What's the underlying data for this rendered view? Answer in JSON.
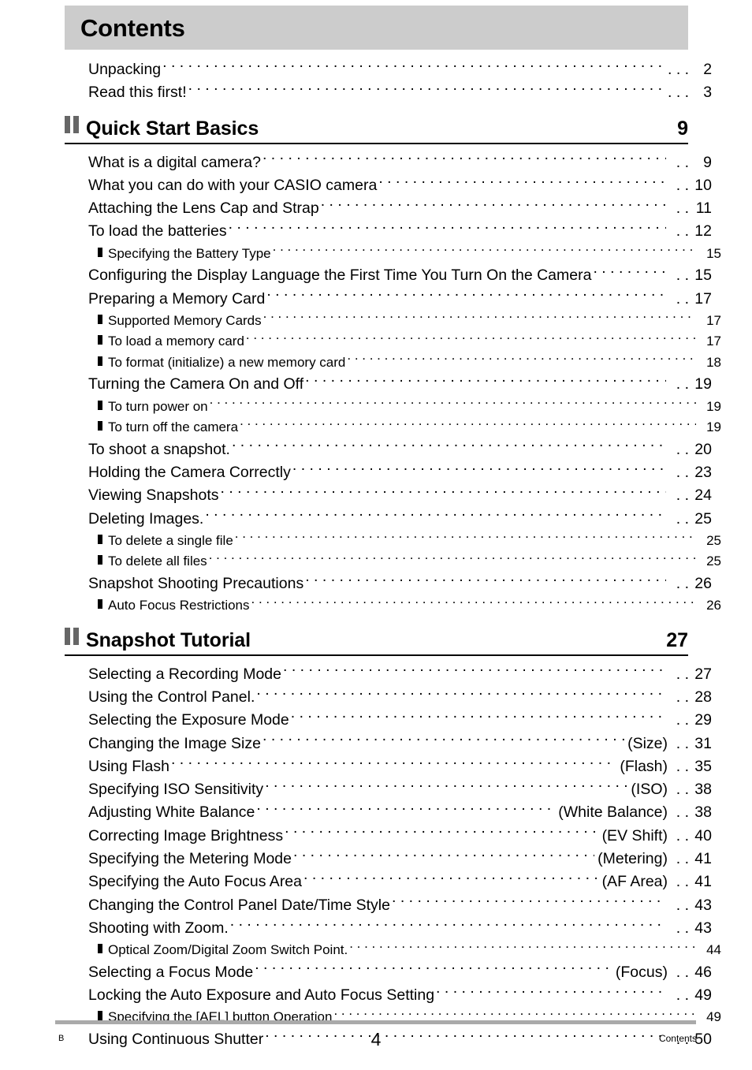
{
  "header": {
    "title": "Contents"
  },
  "intro_items": [
    {
      "label": "Unpacking",
      "page": "2"
    },
    {
      "label": "Read this first!",
      "page": "3"
    }
  ],
  "sections": [
    {
      "icon": "double-bar-icon",
      "title": "Quick Start Basics",
      "page": "9",
      "items": [
        {
          "level": 1,
          "label": "What is a digital camera?",
          "suffix": "",
          "page": "9"
        },
        {
          "level": 1,
          "label": "What you can do with your CASIO camera",
          "suffix": "",
          "page": "10"
        },
        {
          "level": 1,
          "label": "Attaching the Lens Cap and Strap",
          "suffix": "",
          "page": "11"
        },
        {
          "level": 1,
          "label": "To load the batteries",
          "suffix": "",
          "page": "12"
        },
        {
          "level": 2,
          "label": "Specifying the Battery Type",
          "suffix": "",
          "page": "15"
        },
        {
          "level": 1,
          "label": "Configuring the Display Language the First Time You Turn On the Camera",
          "suffix": "",
          "page": "15"
        },
        {
          "level": 1,
          "label": "Preparing a Memory Card",
          "suffix": "",
          "page": "17"
        },
        {
          "level": 2,
          "label": "Supported Memory Cards",
          "suffix": "",
          "page": "17"
        },
        {
          "level": 2,
          "label": "To load a memory card",
          "suffix": "",
          "page": "17"
        },
        {
          "level": 2,
          "label": "To format (initialize) a new memory card",
          "suffix": "",
          "page": "18"
        },
        {
          "level": 1,
          "label": "Turning the Camera On and Off",
          "suffix": "",
          "page": "19"
        },
        {
          "level": 2,
          "label": "To turn power on",
          "suffix": "",
          "page": "19"
        },
        {
          "level": 2,
          "label": "To turn off the camera",
          "suffix": "",
          "page": "19"
        },
        {
          "level": 1,
          "label": "To shoot a snapshot.",
          "suffix": "",
          "page": "20"
        },
        {
          "level": 1,
          "label": "Holding the Camera Correctly",
          "suffix": "",
          "page": "23"
        },
        {
          "level": 1,
          "label": "Viewing Snapshots",
          "suffix": "",
          "page": "24"
        },
        {
          "level": 1,
          "label": "Deleting Images.",
          "suffix": "",
          "page": "25"
        },
        {
          "level": 2,
          "label": "To delete a single file",
          "suffix": "",
          "page": "25"
        },
        {
          "level": 2,
          "label": "To delete all files",
          "suffix": "",
          "page": "25"
        },
        {
          "level": 1,
          "label": "Snapshot Shooting Precautions",
          "suffix": "",
          "page": "26"
        },
        {
          "level": 2,
          "label": "Auto Focus Restrictions",
          "suffix": "",
          "page": "26"
        }
      ]
    },
    {
      "icon": "double-bar-icon",
      "title": "Snapshot Tutorial",
      "page": "27",
      "items": [
        {
          "level": 1,
          "label": "Selecting a Recording Mode",
          "suffix": "",
          "page": "27"
        },
        {
          "level": 1,
          "label": "Using the Control Panel.",
          "suffix": "",
          "page": "28"
        },
        {
          "level": 1,
          "label": "Selecting the Exposure Mode",
          "suffix": "",
          "page": "29"
        },
        {
          "level": 1,
          "label": "Changing the Image Size",
          "suffix": "(Size)",
          "page": "31"
        },
        {
          "level": 1,
          "label": "Using Flash",
          "suffix": "(Flash)",
          "page": "35"
        },
        {
          "level": 1,
          "label": "Specifying ISO Sensitivity",
          "suffix": "(ISO)",
          "page": "38"
        },
        {
          "level": 1,
          "label": "Adjusting White Balance",
          "suffix": "(White Balance)",
          "page": "38"
        },
        {
          "level": 1,
          "label": "Correcting Image Brightness",
          "suffix": "(EV Shift)",
          "page": "40"
        },
        {
          "level": 1,
          "label": "Specifying the Metering Mode",
          "suffix": "(Metering)",
          "page": "41"
        },
        {
          "level": 1,
          "label": "Specifying the Auto Focus Area",
          "suffix": "(AF Area)",
          "page": "41"
        },
        {
          "level": 1,
          "label": "Changing the Control Panel Date/Time Style",
          "suffix": "",
          "page": "43"
        },
        {
          "level": 1,
          "label": "Shooting with Zoom.",
          "suffix": "",
          "page": "43"
        },
        {
          "level": 2,
          "label": "Optical Zoom/Digital Zoom Switch Point.",
          "suffix": "",
          "page": "44"
        },
        {
          "level": 1,
          "label": "Selecting a Focus Mode",
          "suffix": "(Focus)",
          "page": "46"
        },
        {
          "level": 1,
          "label": "Locking the Auto Exposure and Auto Focus Setting",
          "suffix": "",
          "page": "49"
        },
        {
          "level": 2,
          "label": "Specifying the [AEL] button Operation",
          "suffix": "",
          "page": "49"
        },
        {
          "level": 1,
          "label": "Using Continuous Shutter",
          "suffix": "",
          "page": "50"
        }
      ]
    }
  ],
  "footer": {
    "left": "B",
    "center": "4",
    "right": "Contents"
  },
  "colors": {
    "header_band": "#cccccc",
    "section_icon": "#666666",
    "footer_rule": "#aaaaaa",
    "text": "#000000"
  }
}
